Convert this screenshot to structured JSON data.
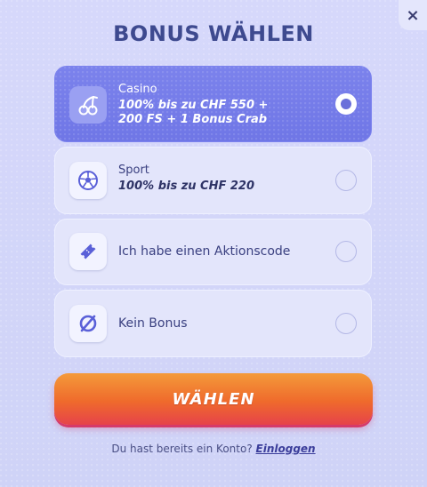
{
  "modal": {
    "title": "BONUS WÄHLEN",
    "close_label": "×"
  },
  "options": [
    {
      "id": "casino",
      "icon": "cherries-icon",
      "label": "Casino",
      "description_line1": "100% bis zu CHF 550 +",
      "description_line2": "200 FS + 1 Bonus Crab",
      "selected": true
    },
    {
      "id": "sport",
      "icon": "soccer-ball-icon",
      "label": "Sport",
      "description_line1": "100% bis zu CHF 220",
      "selected": false
    },
    {
      "id": "promo",
      "icon": "ticket-icon",
      "label": "Ich habe einen Aktionscode",
      "selected": false
    },
    {
      "id": "none",
      "icon": "no-symbol-icon",
      "label": "Kein Bonus",
      "selected": false
    }
  ],
  "cta": {
    "label": "WÄHLEN"
  },
  "footer": {
    "text": "Du hast bereits ein Konto?",
    "link": "Einloggen"
  },
  "colors": {
    "background": "#d3d6f8",
    "selected_card": "#7379e8",
    "card": "#e3e5fb",
    "title": "#3e4a8f",
    "cta_top": "#f49a3a",
    "cta_bottom": "#e6434a"
  }
}
